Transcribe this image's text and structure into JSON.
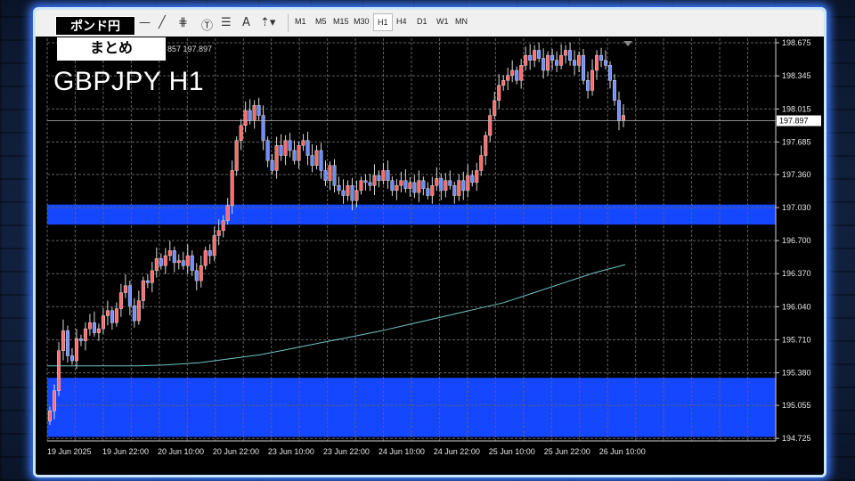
{
  "badge_top": "ポンド円",
  "badge_bottom": "まとめ",
  "title": "GBPJPY H1",
  "info_text": "857 197.897",
  "toolbar": {
    "timeframes": [
      "M1",
      "M5",
      "M15",
      "M30",
      "H1",
      "H4",
      "D1",
      "W1",
      "MN"
    ],
    "active_timeframe": "H1",
    "tool_icons": [
      "line-icon",
      "trendline-icon",
      "fibo-icon",
      "text-icon",
      "hlines-icon",
      "label-icon",
      "arrows-icon"
    ]
  },
  "chart_data": {
    "type": "candlestick",
    "symbol": "GBPJPY",
    "timeframe": "H1",
    "current_price": "197.897",
    "y_ticks": [
      "198.675",
      "198.345",
      "198.015",
      "197.685",
      "197.360",
      "197.030",
      "196.700",
      "196.370",
      "196.040",
      "195.710",
      "195.380",
      "195.055",
      "194.725"
    ],
    "x_ticks": [
      "19 Jun 2025",
      "19 Jun 22:00",
      "20 Jun 10:00",
      "20 Jun 22:00",
      "23 Jun 10:00",
      "23 Jun 22:00",
      "24 Jun 10:00",
      "24 Jun 22:00",
      "25 Jun 10:00",
      "25 Jun 22:00",
      "26 Jun 10:00"
    ],
    "ylim": [
      194.7,
      198.72
    ],
    "zones": [
      {
        "from": 196.86,
        "to": 197.06,
        "color": "#1447ff"
      },
      {
        "from": 194.74,
        "to": 195.33,
        "color": "#1447ff"
      }
    ],
    "colors": {
      "up": "#ff6a6a",
      "down": "#6f8dff",
      "ma": "#74c4c4",
      "grid": "#606060",
      "zone": "#1447ff"
    },
    "ma": [
      195.45,
      195.45,
      195.45,
      195.45,
      195.46,
      195.48,
      195.52,
      195.56,
      195.62,
      195.68,
      195.74,
      195.8,
      195.87,
      195.94,
      196.01,
      196.08,
      196.18,
      196.28,
      196.38,
      196.46
    ],
    "closes": [
      195.0,
      195.2,
      195.6,
      195.8,
      195.55,
      195.5,
      195.72,
      195.7,
      195.82,
      195.88,
      195.78,
      195.82,
      195.95,
      196.0,
      195.88,
      196.02,
      196.18,
      196.25,
      196.05,
      195.9,
      196.1,
      196.3,
      196.28,
      196.4,
      196.52,
      196.45,
      196.55,
      196.6,
      196.48,
      196.5,
      196.45,
      196.55,
      196.4,
      196.3,
      196.45,
      196.6,
      196.55,
      196.75,
      196.8,
      196.9,
      197.05,
      197.4,
      197.7,
      197.85,
      198.0,
      197.9,
      198.05,
      197.95,
      197.7,
      197.5,
      197.4,
      197.65,
      197.55,
      197.7,
      197.6,
      197.5,
      197.65,
      197.7,
      197.55,
      197.45,
      197.6,
      197.4,
      197.3,
      197.45,
      197.25,
      197.2,
      197.15,
      197.25,
      197.1,
      197.2,
      197.3,
      197.28,
      197.25,
      197.35,
      197.3,
      197.4,
      197.3,
      197.2,
      197.25,
      197.3,
      197.22,
      197.28,
      197.18,
      197.3,
      197.22,
      197.15,
      197.25,
      197.32,
      197.2,
      197.3,
      197.25,
      197.15,
      197.3,
      197.2,
      197.35,
      197.28,
      197.4,
      197.55,
      197.75,
      197.95,
      198.1,
      198.25,
      198.3,
      198.35,
      198.4,
      198.3,
      198.45,
      198.55,
      198.5,
      198.6,
      198.52,
      198.4,
      198.55,
      198.5,
      198.45,
      198.55,
      198.6,
      198.5,
      198.45,
      198.55,
      198.3,
      198.2,
      198.4,
      198.55,
      198.5,
      198.45,
      198.3,
      198.1,
      197.9,
      197.95
    ]
  }
}
